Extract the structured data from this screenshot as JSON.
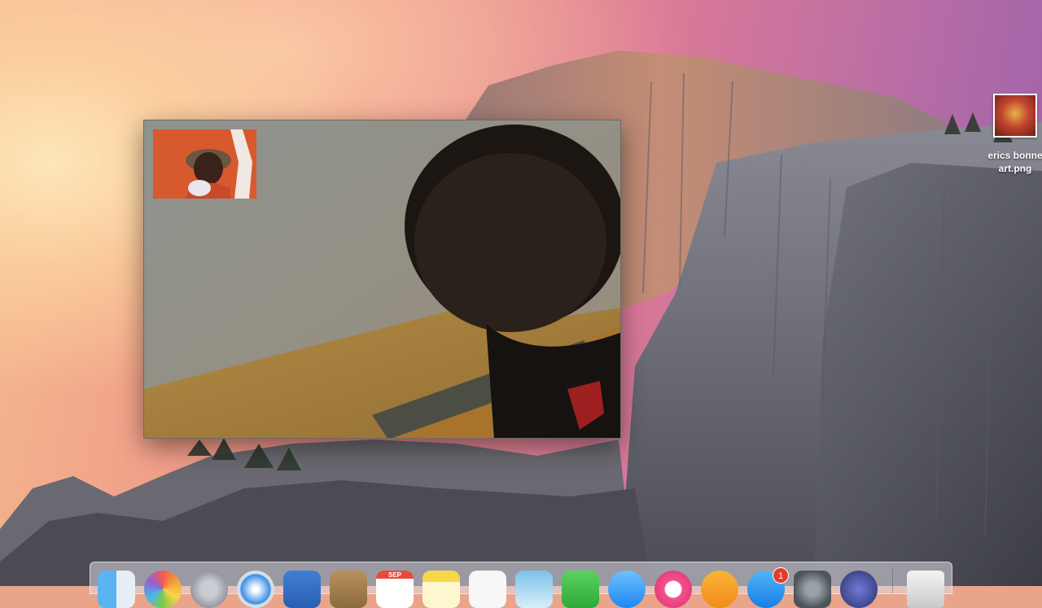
{
  "desktop": {
    "file": {
      "name_line1": "erics bonne",
      "name_line2": "art.png",
      "label": "erics bonne\nart.png"
    }
  },
  "facetime": {
    "window_name": "FaceTime video call",
    "remote_video": "remote participant video",
    "self_preview": "self view preview"
  },
  "dock": {
    "items": [
      {
        "name": "Finder",
        "icon": "finder-icon"
      },
      {
        "name": "Photos",
        "icon": "photos-icon"
      },
      {
        "name": "Launchpad",
        "icon": "launchpad-icon"
      },
      {
        "name": "Safari",
        "icon": "safari-icon"
      },
      {
        "name": "Mail",
        "icon": "mail-icon"
      },
      {
        "name": "Contacts",
        "icon": "contacts-icon"
      },
      {
        "name": "Calendar",
        "icon": "calendar-icon",
        "month": "SEP"
      },
      {
        "name": "Notes",
        "icon": "notes-icon"
      },
      {
        "name": "Reminders",
        "icon": "reminders-icon"
      },
      {
        "name": "Preview",
        "icon": "preview-icon"
      },
      {
        "name": "FaceTime",
        "icon": "facetime-icon"
      },
      {
        "name": "Messages",
        "icon": "messages-icon"
      },
      {
        "name": "iTunes",
        "icon": "itunes-icon"
      },
      {
        "name": "iBooks",
        "icon": "ibooks-icon"
      },
      {
        "name": "App Store",
        "icon": "appstore-icon",
        "badge": "1"
      },
      {
        "name": "System Preferences",
        "icon": "system-preferences-icon"
      },
      {
        "name": "Siri",
        "icon": "siri-icon"
      },
      {
        "name": "Trash",
        "icon": "trash-icon"
      }
    ]
  },
  "colors": {
    "sky_warm": "#f4b98e",
    "sky_pink": "#ef8f86",
    "sky_purple": "#9a63ab",
    "badge_red": "#e53b30"
  }
}
